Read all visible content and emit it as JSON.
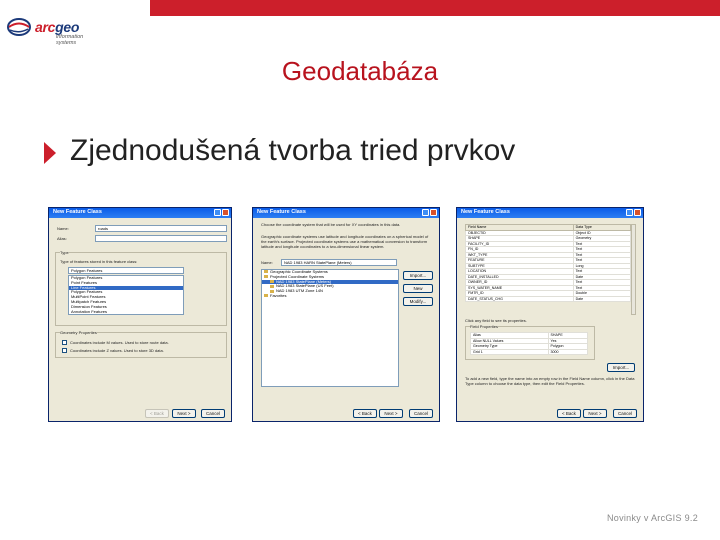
{
  "brand": {
    "logo_text_a": "arc",
    "logo_text_b": "geo",
    "logo_sub_1": "information",
    "logo_sub_2": "systems",
    "accent_color": "#cc1f2b"
  },
  "slide": {
    "title": "Geodatabáza",
    "bullet": "Zjednodušená tvorba tried prvkov",
    "footer": "Novinky v ArcGIS 9.2"
  },
  "dialog1": {
    "title": "New Feature Class",
    "name_label": "Name:",
    "name_value": "roads",
    "alias_label": "Alias:",
    "type_group": "Type",
    "type_prompt": "Type of features stored in this feature class:",
    "selected_type": "Polygon Features",
    "types": [
      "Polygon Features",
      "Point Features",
      "Line Features",
      "Polygon Features",
      "MultiPoint Features",
      "Multipatch Features",
      "Dimension Features",
      "Annotation Features"
    ],
    "geometry_group": "Geometry Properties",
    "opt_m": "Coordinates include M values. Used to store route data.",
    "opt_z": "Coordinates include Z values. Used to store 3D data.",
    "back_label": "< Back",
    "next_label": "Next >",
    "cancel_label": "Cancel"
  },
  "dialog2": {
    "title": "New Feature Class",
    "intro_1": "Choose the coordinate system that will be used for XY coordinates in this data.",
    "intro_2": "Geographic coordinate systems use latitude and longitude coordinates on a spherical model of the earth's surface. Projected coordinate systems use a mathematical conversion to transform latitude and longitude coordinates to a two-dimensional linear system.",
    "name_label": "Name:",
    "name_value": "NAD 1983 HARN StatePlane (Meters)",
    "tree_items": [
      "Geographic Coordinate Systems",
      "Projected Coordinate Systems",
      "NAD 1983 StatePlane (Meters)",
      "NAD 1983 StatePlane (US Feet)",
      "NAD 1983 UTM Zone 14N",
      "Favorites"
    ],
    "import_label": "Import...",
    "new_label": "New",
    "modify_label": "Modify...",
    "back_label": "< Back",
    "next_label": "Next >",
    "cancel_label": "Cancel"
  },
  "dialog3": {
    "title": "New Feature Class",
    "col_field": "Field Name",
    "col_type": "Data Type",
    "fields": [
      [
        "OBJECTID",
        "Object ID"
      ],
      [
        "SHAPE",
        "Geometry"
      ],
      [
        "FACILITY_ID",
        "Text"
      ],
      [
        "FN_ID",
        "Text"
      ],
      [
        "WKT_TYPE",
        "Text"
      ],
      [
        "FEATURE",
        "Text"
      ],
      [
        "SUBTYPE",
        "Long"
      ],
      [
        "LOCATION",
        "Text"
      ],
      [
        "DATE_INSTALLED",
        "Date"
      ],
      [
        "OWNER_ID",
        "Text"
      ],
      [
        "SYS_WATER_NAME",
        "Text"
      ],
      [
        "FMTR_ID",
        "Double"
      ],
      [
        "DATE_STATUS_CHG",
        "Date"
      ]
    ],
    "props_hint": "Click any field to see its properties.",
    "props_group": "Field Properties",
    "props": [
      [
        "Alias",
        "SHAPE"
      ],
      [
        "Allow NULL Values",
        "Yes"
      ],
      [
        "Geometry Type",
        "Polygon"
      ],
      [
        "Grid 1",
        "3000"
      ]
    ],
    "import_label": "Import...",
    "hint_bottom": "To add a new field, type the name into an empty row in the Field Name column, click in the Data Type column to choose the data type, then edit the Field Properties.",
    "back_label": "< Back",
    "next_label": "Next >",
    "cancel_label": "Cancel"
  }
}
